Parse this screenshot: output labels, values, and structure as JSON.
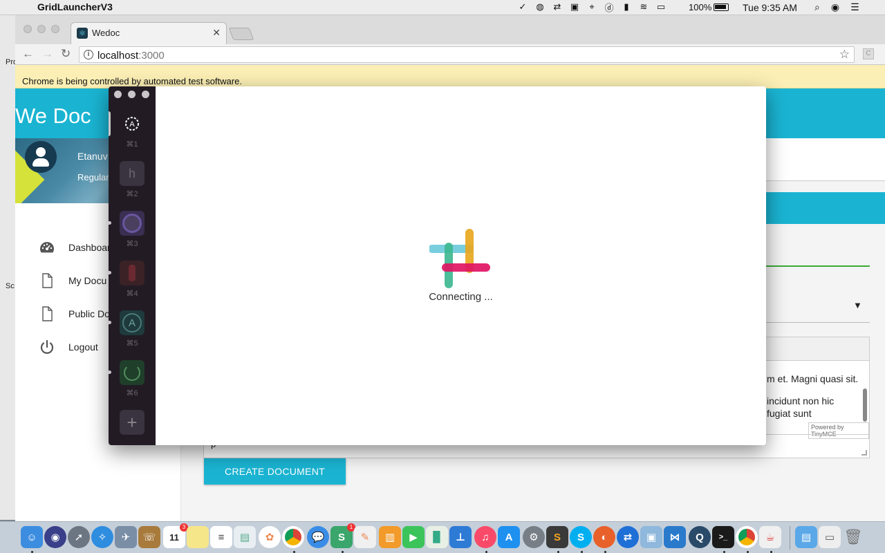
{
  "menubar": {
    "app_name": "GridLauncherV3",
    "battery": "100%",
    "clock": "Tue 9:35 AM"
  },
  "background_window": {
    "label_1": "Pro",
    "label_2": "Sc"
  },
  "browser": {
    "tab_title": "Wedoc",
    "url_host": "localhost",
    "url_port": ":3000",
    "infobar": "Chrome is being controlled by automated test software.",
    "extension_letter": "C"
  },
  "app": {
    "brand": "We Doc",
    "profile": {
      "name": "Etanuv",
      "role": "Regular"
    },
    "nav": [
      {
        "label": "Dashboar",
        "icon": "dashboard-icon"
      },
      {
        "label": "My Docu",
        "icon": "document-icon"
      },
      {
        "label": "Public Do",
        "icon": "document-icon"
      },
      {
        "label": "Logout",
        "icon": "power-icon"
      }
    ],
    "editor": {
      "line_1": "m et. Magni quasi sit.",
      "line_2": "incidunt non hic",
      "line_3": "fugiat sunt",
      "powered_by": "Powered by TinyMCE",
      "status_path": "p"
    },
    "create_button": "CREATE DOCUMENT"
  },
  "slack": {
    "status": "Connecting ...",
    "teams": [
      {
        "key": "⌘1",
        "letter": "A",
        "color": "#2d4fd8"
      },
      {
        "key": "⌘2",
        "letter": "h",
        "color": "#3a3340"
      },
      {
        "key": "⌘3",
        "letter": "",
        "color": "#3a2f52"
      },
      {
        "key": "⌘4",
        "letter": "",
        "color": "#3a2226"
      },
      {
        "key": "⌘5",
        "letter": "A",
        "color": "#1f3a3c"
      },
      {
        "key": "⌘6",
        "letter": "",
        "color": "#1f3f2a"
      }
    ],
    "add_team": "+"
  },
  "dock": {
    "calendar_date": "11",
    "calendar_badge": "3",
    "notification_badge": "1"
  }
}
